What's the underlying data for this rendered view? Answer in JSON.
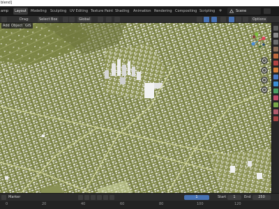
{
  "window": {
    "title": "blend]"
  },
  "menu": {
    "file_label": "amp"
  },
  "workspace_tabs": [
    {
      "label": "Layout",
      "active": true
    },
    {
      "label": "Modeling",
      "active": false
    },
    {
      "label": "Sculpting",
      "active": false
    },
    {
      "label": "UV Editing",
      "active": false
    },
    {
      "label": "Texture Paint",
      "active": false
    },
    {
      "label": "Shading",
      "active": false
    },
    {
      "label": "Animation",
      "active": false
    },
    {
      "label": "Rendering",
      "active": false
    },
    {
      "label": "Compositing",
      "active": false
    },
    {
      "label": "Scripting",
      "active": false
    }
  ],
  "workspace_add": "+",
  "scene": {
    "label": "Scene"
  },
  "viewport_header": {
    "mode_icon": "object-mode-icon",
    "drag_label": "Drag:",
    "select_box_label": "Select Box",
    "transform_orientation": "Global",
    "options_label": "Options"
  },
  "viewport_sub_header": {
    "add_label": "Add",
    "object_label": "Object",
    "gis_label": "GIS"
  },
  "timeline": {
    "marker_label": "Marker",
    "current_frame": "1",
    "start_label": "Start",
    "start_value": "1",
    "end_label": "End",
    "end_value": "250"
  },
  "colors": {
    "accent": "#4772b3",
    "terrain": "#7f8748",
    "roads": "#c8cc88",
    "buildings": "#e6e6de"
  }
}
